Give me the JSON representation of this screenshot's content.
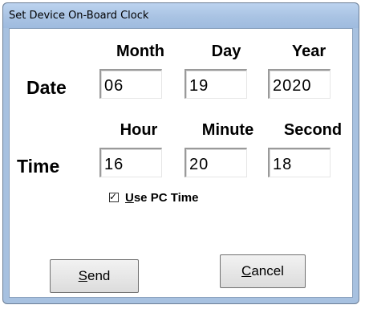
{
  "window": {
    "title": "Set Device On-Board Clock"
  },
  "date_row": {
    "label": "Date",
    "headers": [
      "Month",
      "Day",
      "Year"
    ],
    "values": [
      "06",
      "19",
      "2020"
    ]
  },
  "time_row": {
    "label": "Time",
    "headers": [
      "Hour",
      "Minute",
      "Second"
    ],
    "values": [
      "16",
      "20",
      "18"
    ]
  },
  "use_pc_time": {
    "label_mnemonic": "U",
    "label_rest": "se PC Time",
    "checked": true
  },
  "buttons": {
    "send_mnemonic": "S",
    "send_rest": "end",
    "cancel_mnemonic": "C",
    "cancel_rest": "ancel"
  }
}
